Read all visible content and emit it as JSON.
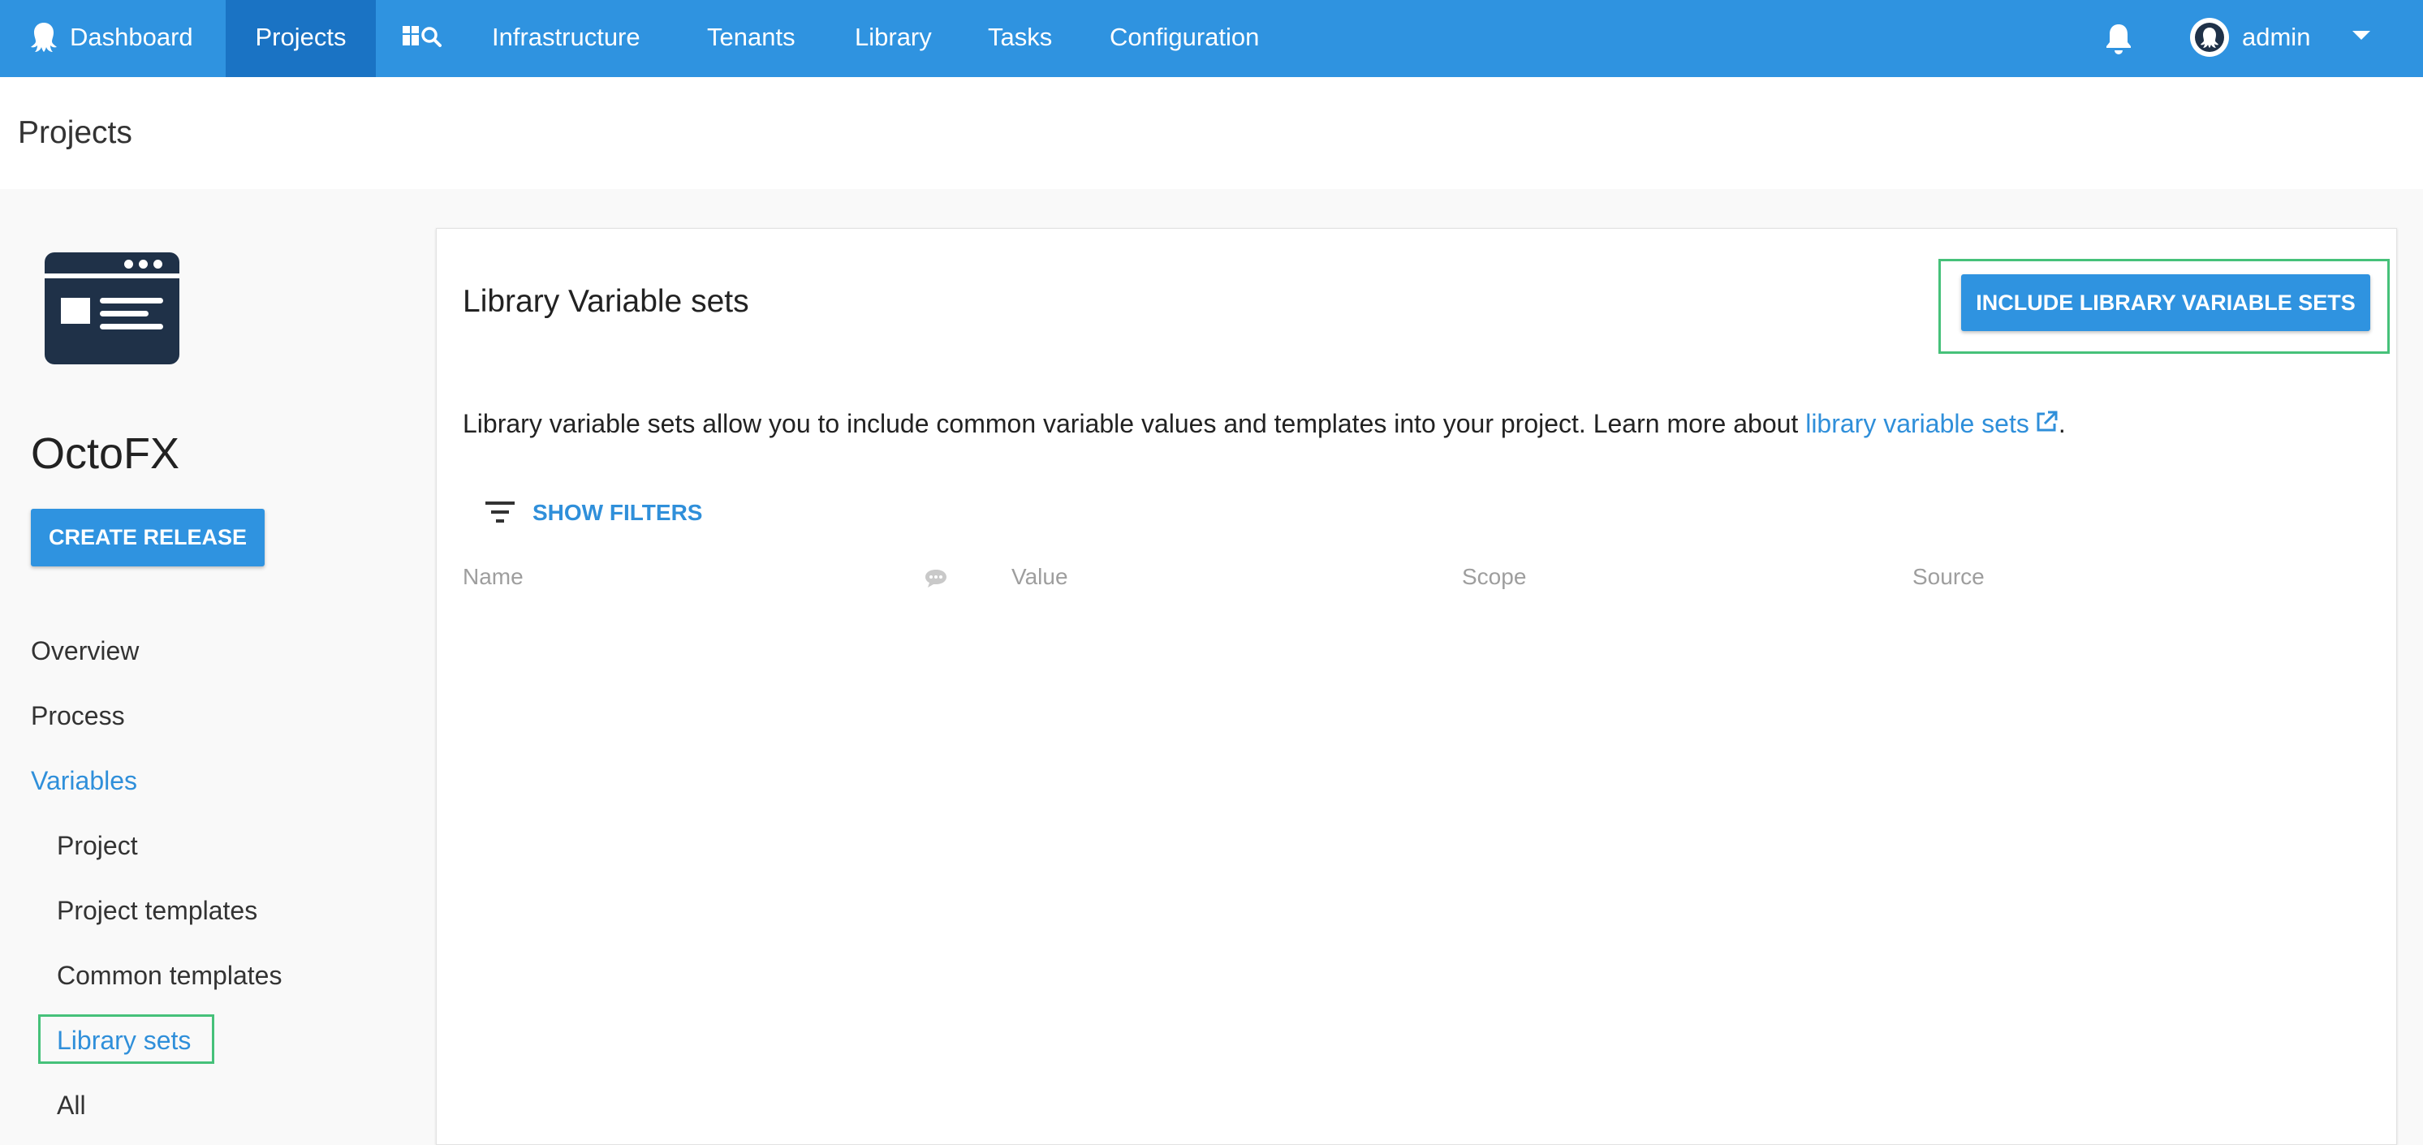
{
  "nav": {
    "dashboard": "Dashboard",
    "projects": "Projects",
    "infrastructure": "Infrastructure",
    "tenants": "Tenants",
    "library": "Library",
    "tasks": "Tasks",
    "configuration": "Configuration",
    "user": "admin",
    "active": "Projects"
  },
  "page": {
    "title": "Projects"
  },
  "sidebar": {
    "project_name": "OctoFX",
    "create_release": "CREATE RELEASE",
    "items": {
      "overview": "Overview",
      "process": "Process",
      "variables": "Variables",
      "project": "Project",
      "project_templates": "Project templates",
      "common_templates": "Common templates",
      "library_sets": "Library sets",
      "all": "All"
    },
    "active_item": "Library sets"
  },
  "main": {
    "title": "Library Variable sets",
    "include_button": "INCLUDE LIBRARY VARIABLE SETS",
    "description": "Library variable sets allow you to include common variable values and templates into your project. Learn more about ",
    "description_link": "library variable sets",
    "description_end": ".",
    "show_filters": "SHOW FILTERS",
    "columns": {
      "name": "Name",
      "value": "Value",
      "scope": "Scope",
      "source": "Source"
    }
  },
  "colors": {
    "nav_bg": "#2f93e0",
    "nav_active": "#1a73c4",
    "link": "#2f8fda",
    "highlight": "#46c17a",
    "logo_bg": "#1f3148"
  }
}
